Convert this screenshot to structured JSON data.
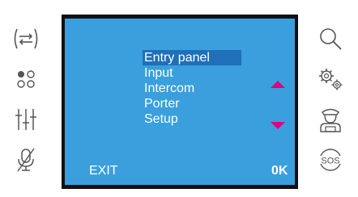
{
  "left_buttons": [
    {
      "icon": "transfer-arrows-icon"
    },
    {
      "icon": "settings-dots-icon"
    },
    {
      "icon": "sliders-icon"
    },
    {
      "icon": "microphone-muted-icon"
    }
  ],
  "right_buttons": [
    {
      "icon": "search-icon"
    },
    {
      "icon": "gears-icon"
    },
    {
      "icon": "porter-icon"
    },
    {
      "icon": "sos-icon"
    }
  ],
  "menu": {
    "items": [
      "Entry panel",
      "Input",
      "Intercom",
      "Porter",
      "Setup"
    ],
    "selected": "Entry panel"
  },
  "softkeys": {
    "left_label": "EXIT",
    "right_label": "0K"
  },
  "sos_label": "SOS",
  "colors": {
    "screen_bg": "#3a9fdc",
    "selection": "#1f6fb9",
    "arrow": "#e0007a",
    "icon": "#555555"
  }
}
